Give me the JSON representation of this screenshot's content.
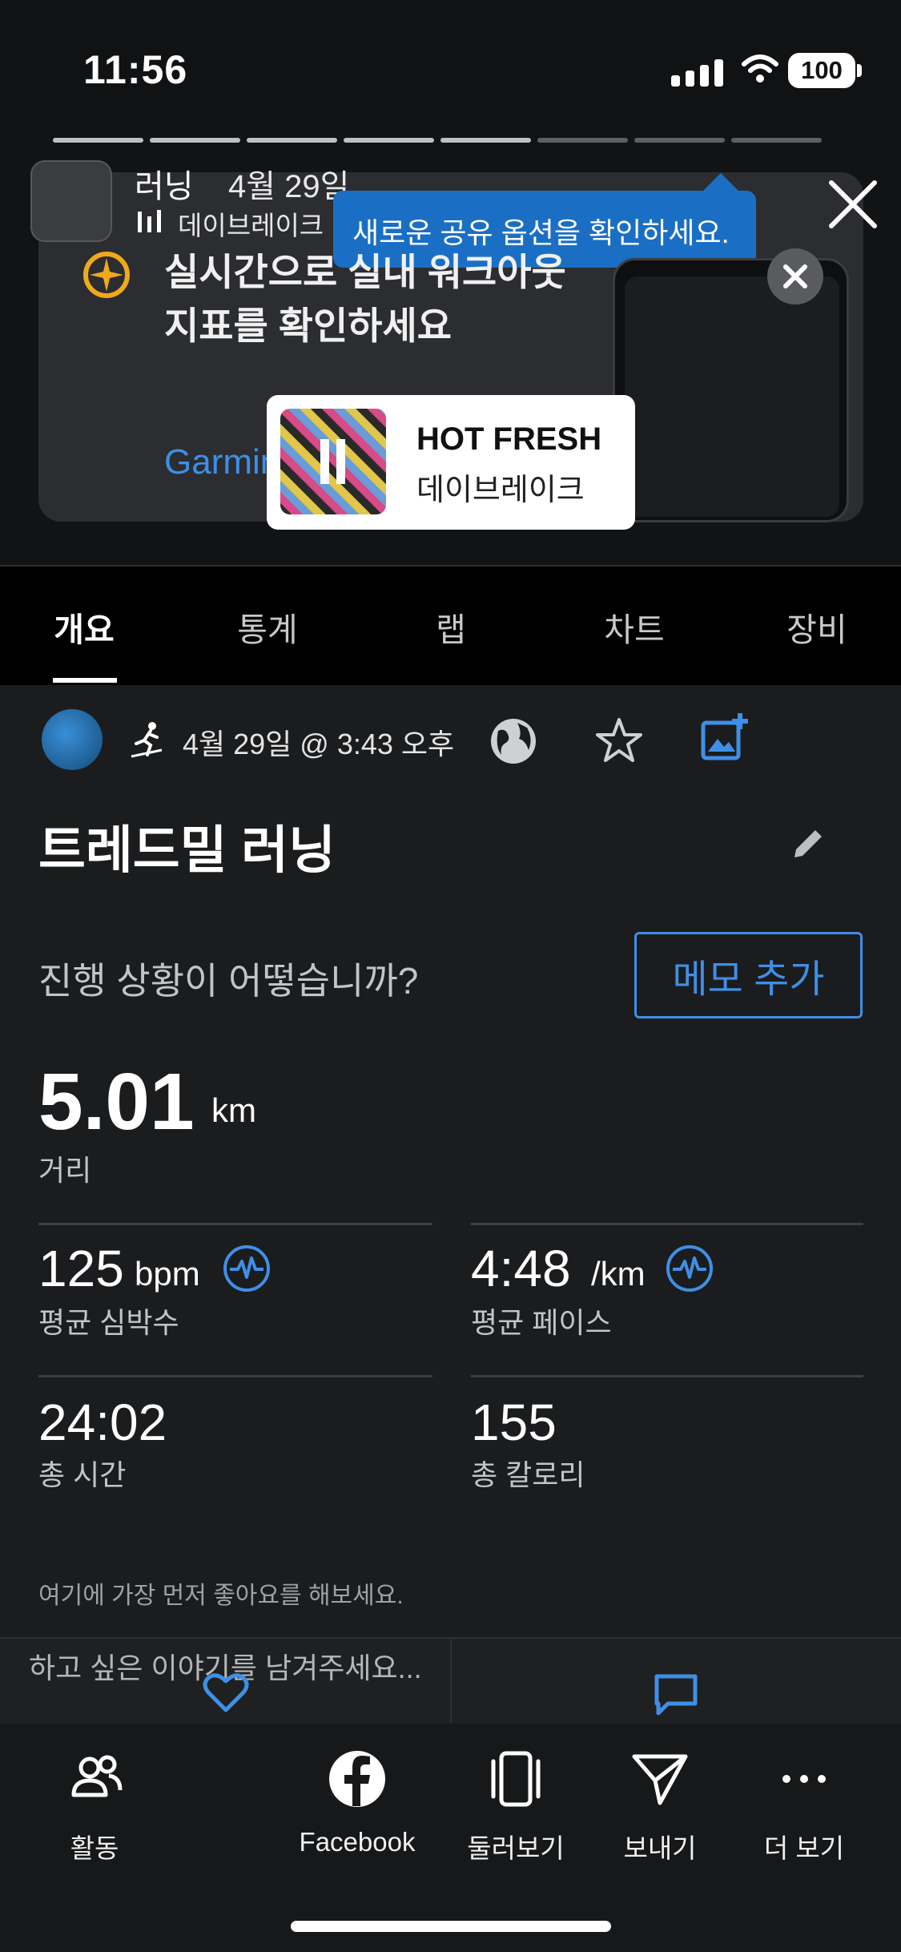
{
  "status": {
    "time": "11:56",
    "battery": "100"
  },
  "story": {
    "header_title": "러닝",
    "header_date": "4월 29일",
    "header_sub": "데이브레이크 · HOT FRESH >",
    "tooltip": "새로운 공유 옵션을 확인하세요.",
    "ad_text": "실시간으로 실내 워크아웃 지표를 확인하세요",
    "ad_link": "Garmin",
    "music_title": "HOT FRESH",
    "music_artist": "데이브레이크"
  },
  "tabs": [
    {
      "label": "개요",
      "active": true
    },
    {
      "label": "통계",
      "active": false
    },
    {
      "label": "랩",
      "active": false
    },
    {
      "label": "차트",
      "active": false
    },
    {
      "label": "장비",
      "active": false
    }
  ],
  "activity": {
    "datetime": "4월 29일 @ 3:43 오후",
    "title": "트레드밀 러닝",
    "question": "진행 상황이 어떻습니까?",
    "memo_button": "메모 추가",
    "distance_value": "5.01",
    "distance_unit": "km",
    "distance_label": "거리",
    "stats": [
      {
        "value": "125",
        "unit": "bpm",
        "label": "평균 심박수",
        "icon": "heart-rate-icon"
      },
      {
        "value": "4:48",
        "unit": "/km",
        "label": "평균 페이스",
        "icon": "heart-rate-icon"
      },
      {
        "value": "24:02",
        "unit": "",
        "label": "총 시간"
      },
      {
        "value": "155",
        "unit": "",
        "label": "총 칼로리"
      }
    ],
    "likes_hint": "여기에 가장 먼저 좋아요를 해보세요.",
    "comment_placeholder": "하고 싶은 이야기를 남겨주세요..."
  },
  "bottom_bar": [
    {
      "label": "활동",
      "icon": "people-icon"
    },
    {
      "label": "Facebook",
      "icon": "facebook-icon"
    },
    {
      "label": "둘러보기",
      "icon": "carousel-icon"
    },
    {
      "label": "보내기",
      "icon": "send-icon"
    },
    {
      "label": "더 보기",
      "icon": "more-icon"
    }
  ],
  "colors": {
    "accent": "#3f8fe6",
    "background": "#1b1c1e",
    "tooltip": "#1a6fc4"
  }
}
